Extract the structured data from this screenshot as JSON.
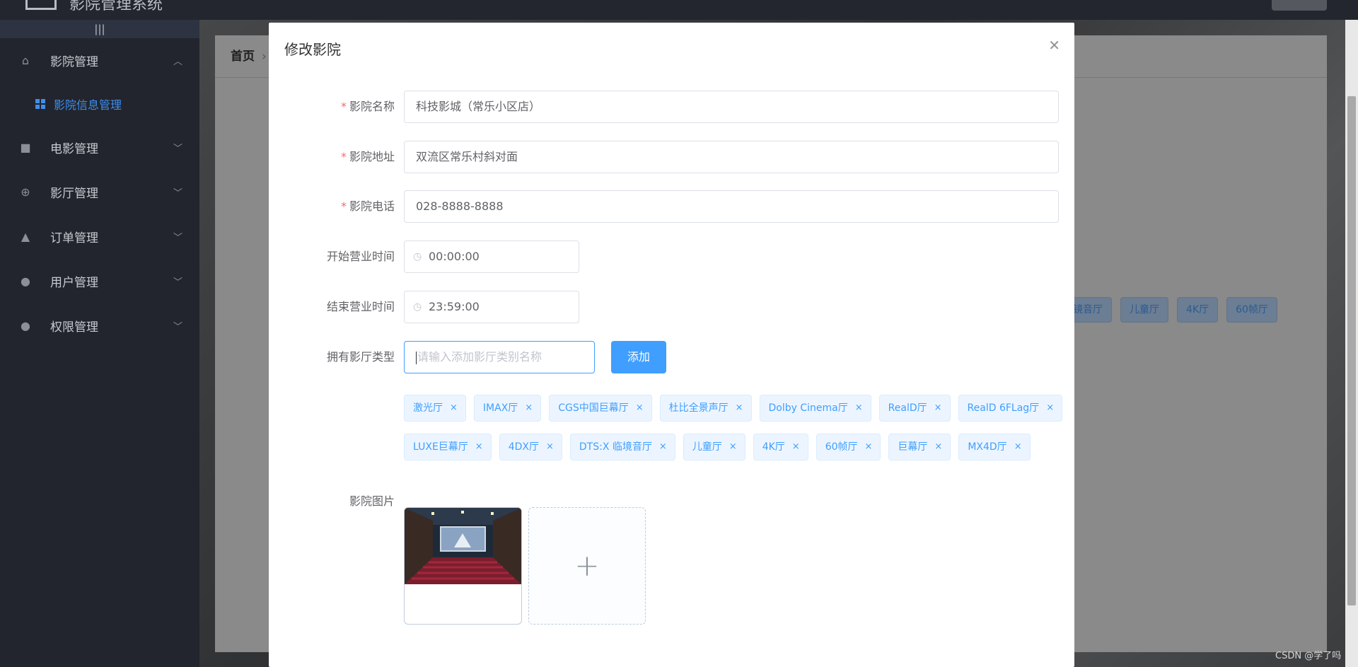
{
  "app": {
    "title": "影院管理系统"
  },
  "sidebar": {
    "collapse_glyph": "|||",
    "items": [
      {
        "label": "影院管理",
        "icon": "home-icon",
        "expanded": true
      },
      {
        "label": "电影管理",
        "icon": "video-camera-icon"
      },
      {
        "label": "影厅管理",
        "icon": "target-icon"
      },
      {
        "label": "订单管理",
        "icon": "bell-icon"
      },
      {
        "label": "用户管理",
        "icon": "user-icon"
      },
      {
        "label": "权限管理",
        "icon": "user-icon"
      }
    ],
    "sub_item": {
      "label": "影院信息管理",
      "icon": "grid-icon"
    }
  },
  "background_page": {
    "breadcrumb_home": "首页",
    "tags": [
      "镜音厅",
      "儿童厅",
      "4K厅",
      "60帧厅"
    ]
  },
  "modal": {
    "title": "修改影院",
    "fields": {
      "name": {
        "label": "影院名称",
        "value": "科技影城（常乐小区店）",
        "required": true
      },
      "address": {
        "label": "影院地址",
        "value": "双流区常乐村斜对面",
        "required": true
      },
      "phone": {
        "label": "影院电话",
        "value": "028-8888-8888",
        "required": true
      },
      "open_time": {
        "label": "开始营业时间",
        "value": "00:00:00"
      },
      "close_time": {
        "label": "结束营业时间",
        "value": "23:59:00"
      },
      "hall_types": {
        "label": "拥有影厅类型",
        "placeholder": "请输入添加影厅类别名称",
        "add_button": "添加"
      },
      "picture": {
        "label": "影院图片"
      }
    },
    "required_mark": "*",
    "tag_close": "×",
    "tags_row1": [
      "激光厅",
      "IMAX厅",
      "CGS中国巨幕厅",
      "杜比全景声厅",
      "Dolby Cinema厅",
      "RealD厅",
      "RealD 6FLag厅"
    ],
    "tags_row2": [
      "LUXE巨幕厅",
      "4DX厅",
      "DTS:X 临境音厅",
      "儿童厅",
      "4K厅",
      "60帧厅",
      "巨幕厅",
      "MX4D厅"
    ],
    "upload_plus": "+"
  },
  "watermark": "CSDN @学了吗",
  "colors": {
    "primary": "#409eff",
    "required": "#f56c6c",
    "sidebar_bg": "#22252d",
    "active_menu": "#3d8ef0"
  }
}
